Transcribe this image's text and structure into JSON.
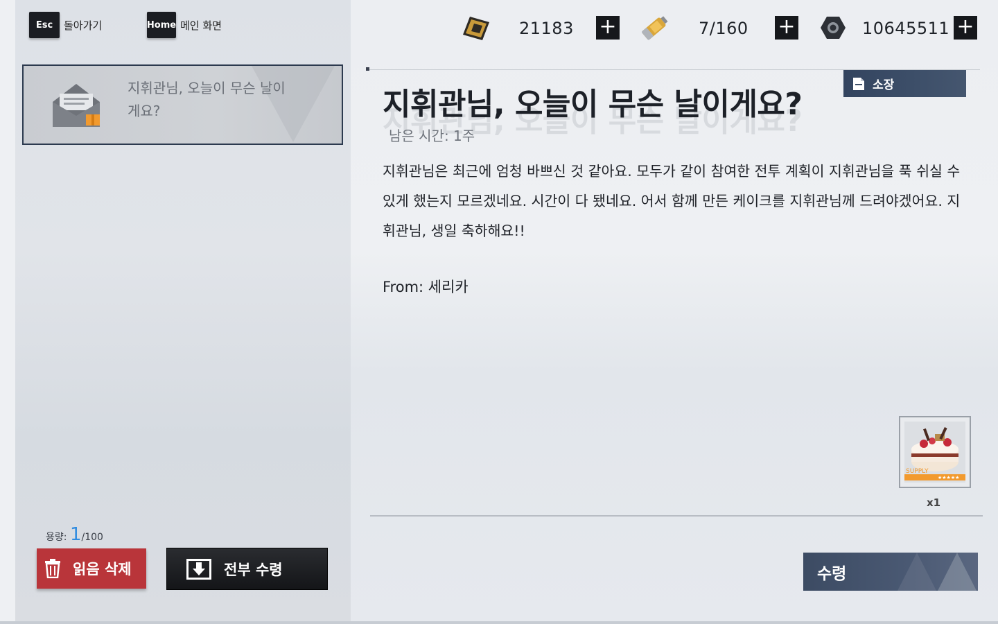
{
  "nav": {
    "back_key": "Esc",
    "back_label": "돌아가기",
    "home_key": "Home",
    "home_label": "메인 화면"
  },
  "mail_list": [
    {
      "subject": "지휘관님, 오늘이 무슨 날이게요?"
    }
  ],
  "capacity": {
    "label": "용량:",
    "current": "1",
    "max": "/100"
  },
  "buttons": {
    "delete_read": "읽음 삭제",
    "receive_all": "전부 수령",
    "save": "소장",
    "receive": "수령"
  },
  "currencies": [
    {
      "icon": "ticket-icon",
      "value": "21183"
    },
    {
      "icon": "battery-icon",
      "value": "7/160"
    },
    {
      "icon": "nut-icon",
      "value": "10645511"
    }
  ],
  "mail": {
    "title": "지휘관님, 오늘이 무슨 날이게요?",
    "remaining": "남은 시간: 1주",
    "body": "지휘관님은 최근에 엄청 바쁘신 것 같아요. 모두가 같이 참여한 전투 계획이 지휘관님을 푹 쉬실 수 있게 했는지 모르겠네요. 시간이 다 됐네요. 어서 함께 만든 케이크를 지휘관님께 드려야겠어요. 지휘관님, 생일 축하해요!!",
    "from": "From: 세리카"
  },
  "reward": {
    "icon": "cake-icon",
    "badge": "SUPPLY",
    "stars": "★★★★★",
    "quantity": "x1"
  },
  "colors": {
    "delete_red": "#b9353a",
    "accent_blue": "#2f8be0",
    "navy": "#33445f"
  }
}
